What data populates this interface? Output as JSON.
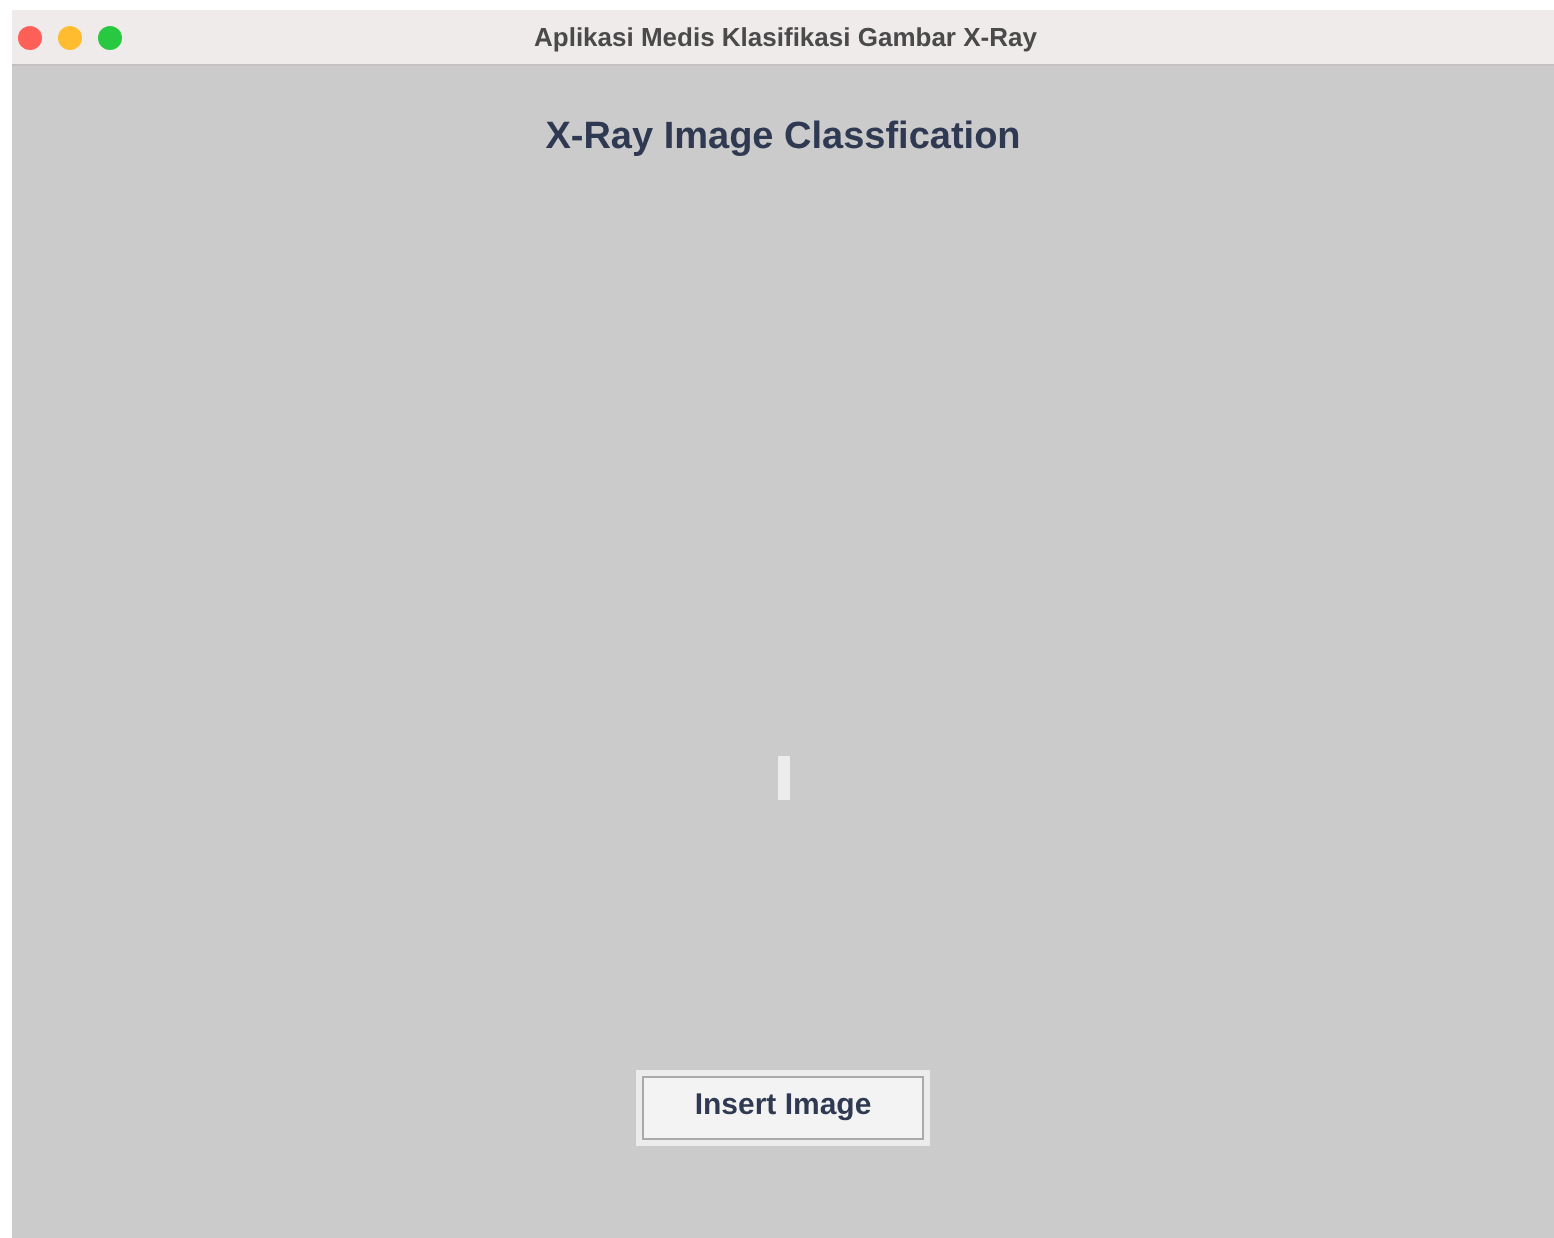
{
  "window": {
    "title": "Aplikasi Medis Klasifikasi Gambar X-Ray"
  },
  "heading": "X-Ray Image Classfication",
  "buttons": [
    {
      "label": "Insert Image"
    }
  ]
}
